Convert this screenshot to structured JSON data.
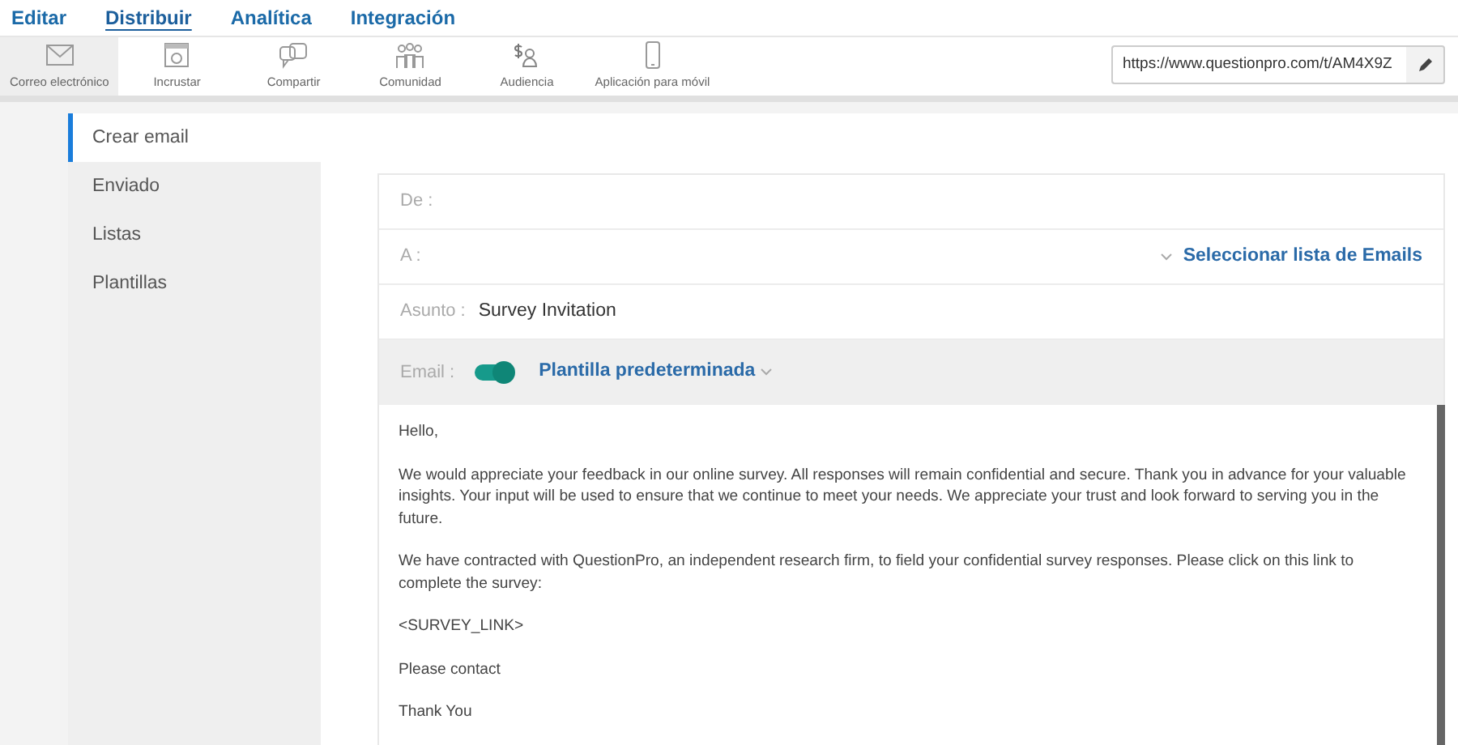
{
  "menu": [
    {
      "label": "Editar",
      "selected": false
    },
    {
      "label": "Distribuir",
      "selected": true
    },
    {
      "label": "Analítica",
      "selected": false
    },
    {
      "label": "Integración",
      "selected": false
    }
  ],
  "toolbar": [
    {
      "label": "Correo electrónico",
      "kind": "envelope",
      "selected": true
    },
    {
      "label": "Incrustar",
      "kind": "embed",
      "selected": false
    },
    {
      "label": "Compartir",
      "kind": "share",
      "selected": false
    },
    {
      "label": "Comunidad",
      "kind": "community",
      "selected": false
    },
    {
      "label": "Audiencia",
      "kind": "audience",
      "selected": false
    },
    {
      "label": "Aplicación para móvil",
      "kind": "mobile",
      "selected": false
    }
  ],
  "url_field": {
    "value": "https://www.questionpro.com/t/AM4X9Z"
  },
  "sidebar": {
    "items": [
      {
        "label": "Crear email",
        "selected": true
      },
      {
        "label": "Enviado",
        "selected": false
      },
      {
        "label": "Listas",
        "selected": false
      },
      {
        "label": "Plantillas",
        "selected": false
      }
    ]
  },
  "compose": {
    "from_label": "De :",
    "to_label": "A :",
    "list_link": "Seleccionar lista de Emails",
    "subject_label": "Asunto :",
    "subject": "Survey Invitation",
    "email_label": "Email :",
    "email_on": true,
    "template": "Plantilla predeterminada",
    "body": [
      "Hello,",
      "We would appreciate your feedback in our online survey.  All responses will remain confidential and secure.  Thank you in advance for your valuable insights.  Your input will be used to ensure that we continue to meet your needs. We appreciate your trust and look forward to serving you in the future.",
      "We have contracted with QuestionPro, an independent research firm, to field your confidential survey responses.  Please click on this link to complete the survey:",
      "<SURVEY_LINK>",
      "Please contact",
      "Thank You"
    ]
  }
}
